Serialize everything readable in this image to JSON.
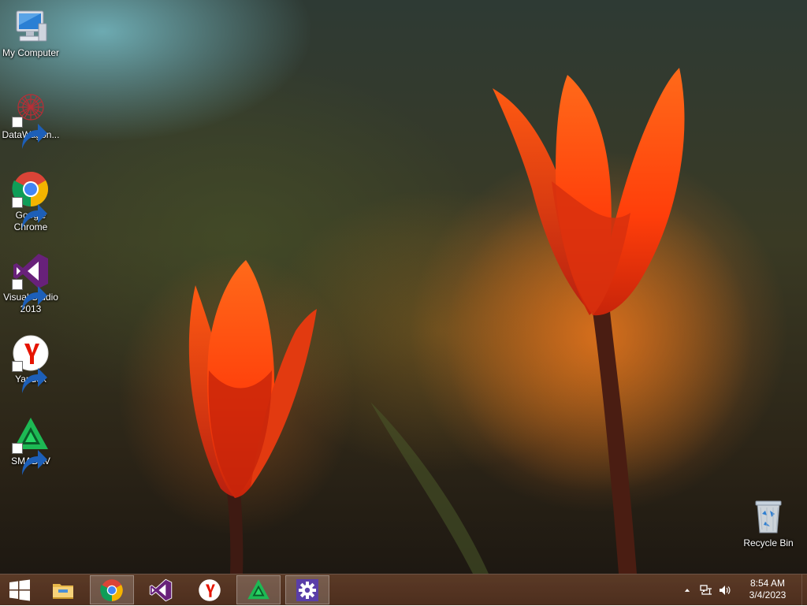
{
  "desktop": {
    "icons": [
      {
        "label": "My Computer",
        "icon": "computer-icon"
      },
      {
        "label": "DataWagon...",
        "icon": "datawagon-icon"
      },
      {
        "label": "Google Chrome",
        "icon": "chrome-icon"
      },
      {
        "label": "Visual Studio 2013",
        "icon": "visual-studio-icon"
      },
      {
        "label": "Yandex",
        "icon": "yandex-icon"
      },
      {
        "label": "SMADAV",
        "icon": "smadav-icon"
      }
    ],
    "recycle_bin": {
      "label": "Recycle Bin",
      "icon": "recycle-bin-icon"
    }
  },
  "taskbar": {
    "start": {
      "icon": "windows-logo-icon"
    },
    "pinned": [
      {
        "icon": "file-explorer-icon",
        "active": false
      },
      {
        "icon": "chrome-icon",
        "active": true
      },
      {
        "icon": "visual-studio-icon",
        "active": false
      },
      {
        "icon": "yandex-icon",
        "active": false
      },
      {
        "icon": "smadav-icon",
        "active": true
      },
      {
        "icon": "settings-gear-icon",
        "active": true
      }
    ],
    "tray": {
      "icons": [
        "show-hidden-icons-icon",
        "network-icon",
        "volume-icon"
      ],
      "time": "8:54 AM",
      "date": "3/4/2023"
    }
  },
  "colors": {
    "taskbar": "#5f3c28",
    "chrome_red": "#db4437",
    "chrome_green": "#0f9d58",
    "chrome_yellow": "#f4b400",
    "chrome_blue": "#4285f4",
    "vs_purple": "#68217a",
    "yandex_red": "#e61400",
    "smadav_green": "#1db954",
    "settings_purple": "#5a3ea8",
    "tulip_orange": "#ff4a12"
  }
}
